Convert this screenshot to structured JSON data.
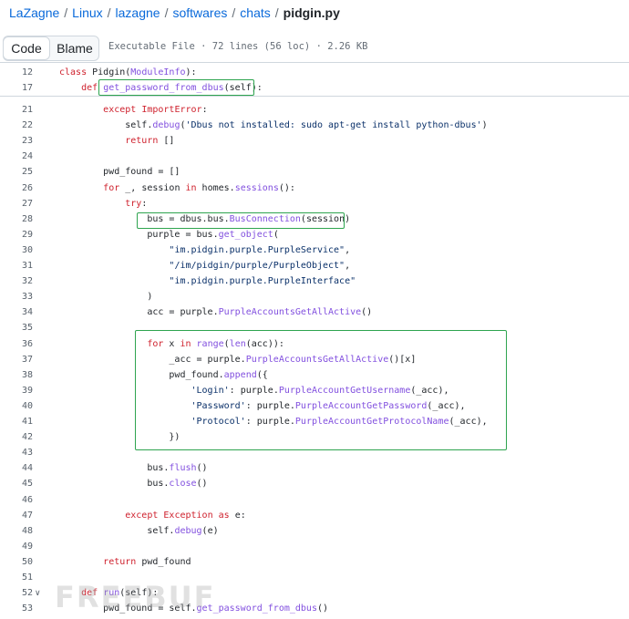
{
  "breadcrumb": {
    "items": [
      "LaZagne",
      "Linux",
      "lazagne",
      "softwares",
      "chats"
    ],
    "separator": "/",
    "current": "pidgin.py"
  },
  "toolbar": {
    "code_label": "Code",
    "blame_label": "Blame",
    "file_meta": "Executable File · 72 lines (56 loc) · 2.26 KB"
  },
  "sticky_lines": [
    {
      "num": "12",
      "code": "class Pidgin(ModuleInfo):"
    },
    {
      "num": "17",
      "code": "    def get_password_from_dbus(self):"
    }
  ],
  "code_lines": [
    {
      "num": "21",
      "code": "        except ImportError:"
    },
    {
      "num": "22",
      "code": "            self.debug('Dbus not installed: sudo apt-get install python-dbus')"
    },
    {
      "num": "23",
      "code": "            return []"
    },
    {
      "num": "24",
      "code": ""
    },
    {
      "num": "25",
      "code": "        pwd_found = []"
    },
    {
      "num": "26",
      "code": "        for _, session in homes.sessions():"
    },
    {
      "num": "27",
      "code": "            try:"
    },
    {
      "num": "28",
      "code": "                bus = dbus.bus.BusConnection(session)"
    },
    {
      "num": "29",
      "code": "                purple = bus.get_object("
    },
    {
      "num": "30",
      "code": "                    \"im.pidgin.purple.PurpleService\","
    },
    {
      "num": "31",
      "code": "                    \"/im/pidgin/purple/PurpleObject\","
    },
    {
      "num": "32",
      "code": "                    \"im.pidgin.purple.PurpleInterface\""
    },
    {
      "num": "33",
      "code": "                )"
    },
    {
      "num": "34",
      "code": "                acc = purple.PurpleAccountsGetAllActive()"
    },
    {
      "num": "35",
      "code": ""
    },
    {
      "num": "36",
      "code": "                for x in range(len(acc)):"
    },
    {
      "num": "37",
      "code": "                    _acc = purple.PurpleAccountsGetAllActive()[x]"
    },
    {
      "num": "38",
      "code": "                    pwd_found.append({"
    },
    {
      "num": "39",
      "code": "                        'Login': purple.PurpleAccountGetUsername(_acc),"
    },
    {
      "num": "40",
      "code": "                        'Password': purple.PurpleAccountGetPassword(_acc),"
    },
    {
      "num": "41",
      "code": "                        'Protocol': purple.PurpleAccountGetProtocolName(_acc),"
    },
    {
      "num": "42",
      "code": "                    })"
    },
    {
      "num": "43",
      "code": ""
    },
    {
      "num": "44",
      "code": "                bus.flush()"
    },
    {
      "num": "45",
      "code": "                bus.close()"
    },
    {
      "num": "46",
      "code": ""
    },
    {
      "num": "47",
      "code": "            except Exception as e:"
    },
    {
      "num": "48",
      "code": "                self.debug(e)"
    },
    {
      "num": "49",
      "code": ""
    },
    {
      "num": "50",
      "code": "        return pwd_found"
    },
    {
      "num": "51",
      "code": ""
    },
    {
      "num": "52",
      "code": "    def run(self):"
    },
    {
      "num": "53",
      "code": "        pwd_found = self.get_password_from_dbus()"
    }
  ],
  "fold_icon_line": "52",
  "watermark": "FREEBUF",
  "colors": {
    "keyword": "#cf222e",
    "function": "#8250df",
    "string": "#0a3069",
    "highlight_box": "#2ea44f",
    "link": "#0969da"
  }
}
